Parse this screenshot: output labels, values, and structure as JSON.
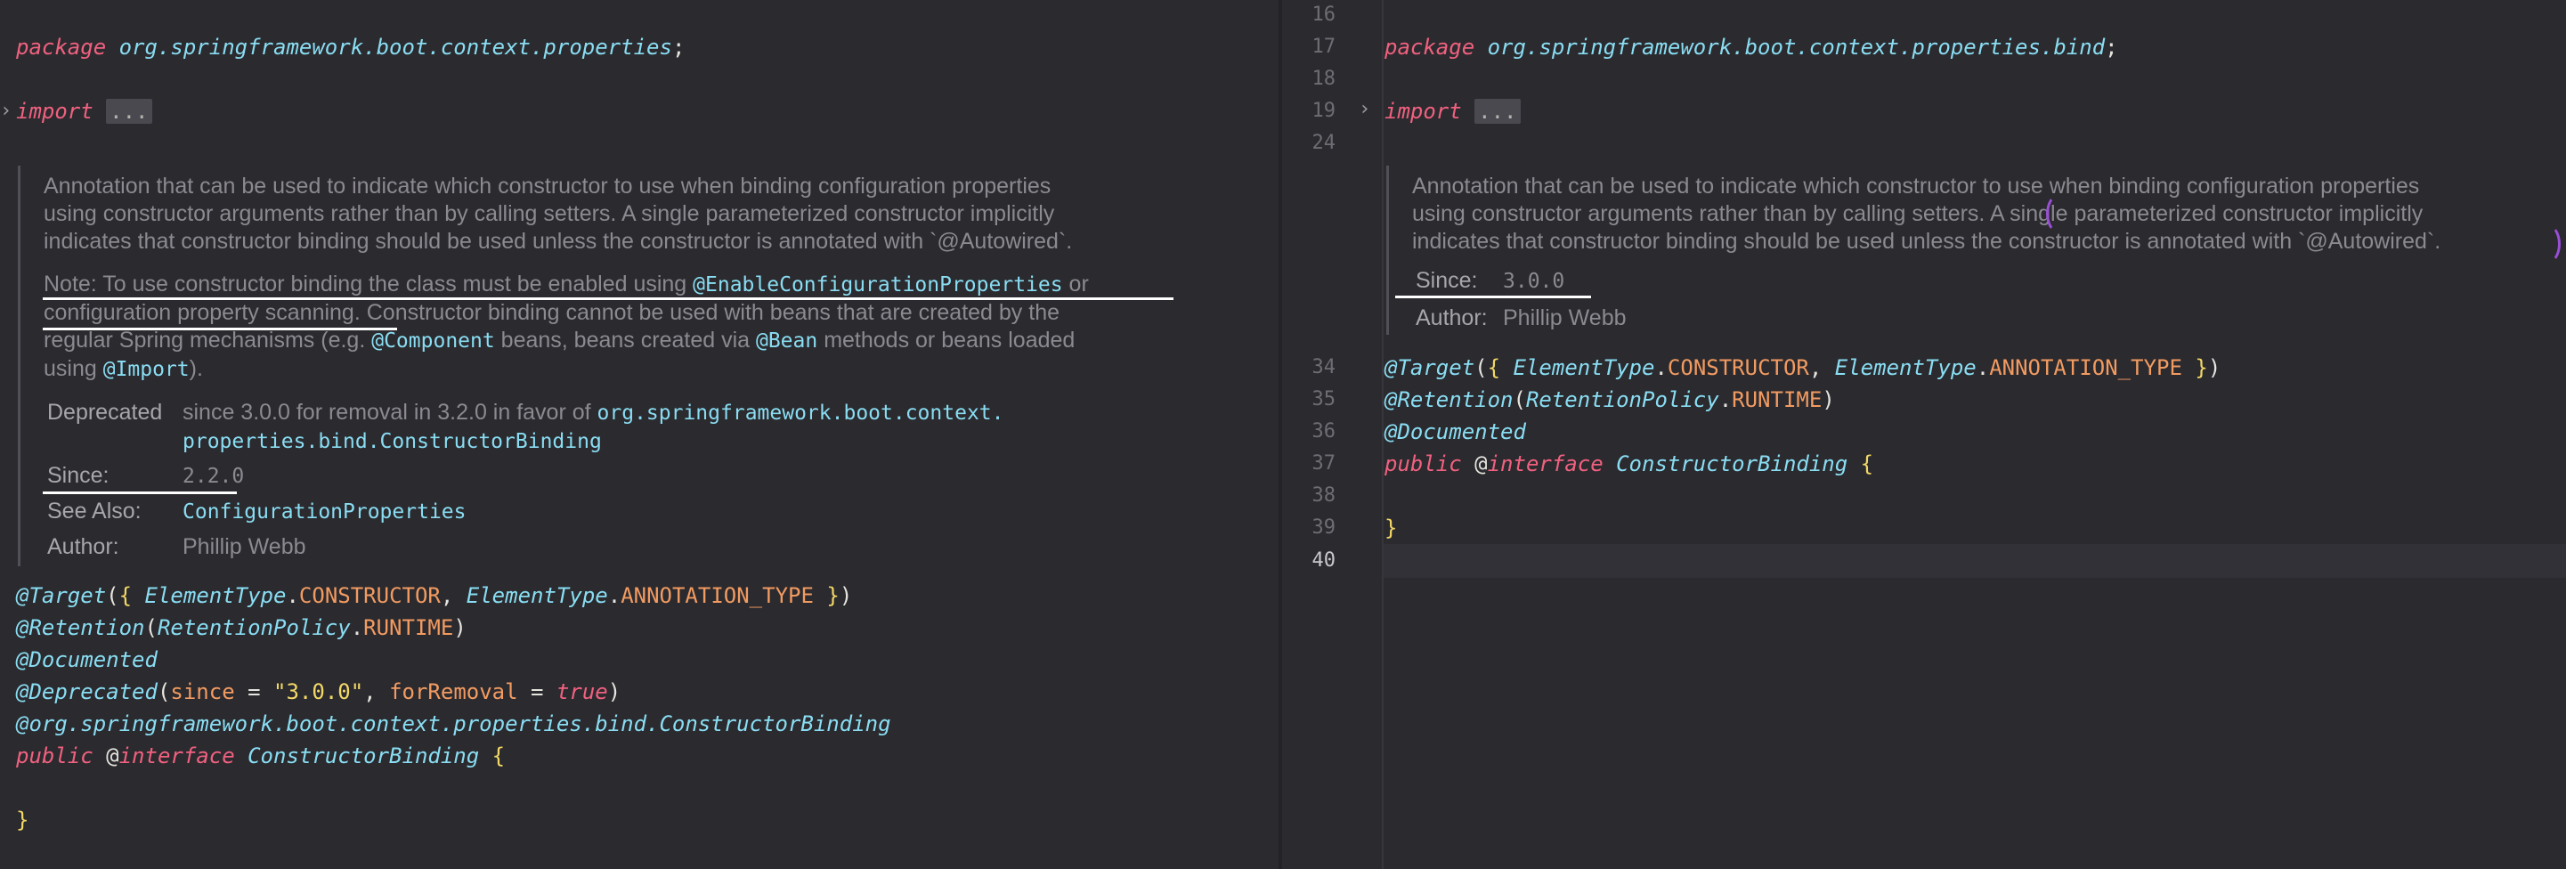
{
  "left": {
    "package_kw": "package",
    "package_name": "org.springframework.boot.context.properties",
    "import_kw": "import",
    "fold_label": "...",
    "doc": {
      "p1": "Annotation that can be used to indicate which constructor to use when binding configuration properties",
      "p2": "using constructor arguments rather than by calling setters. A single parameterized constructor implicitly",
      "p3": "indicates that constructor binding should be used unless the constructor is annotated with `@Autowired`.",
      "note_label": "Note:",
      "note_a": "To use constructor binding the class must be enabled using",
      "note_link1": "@EnableConfigurationProperties",
      "note_or": "or",
      "note_b": "configuration property scanning.",
      "note_c": "Constructor binding cannot be used with beans that are created by the",
      "note_d": "regular Spring mechanisms (e.g.",
      "note_component": "@Component",
      "note_e": "beans, beans created via",
      "note_bean": "@Bean",
      "note_f": "methods or beans loaded",
      "note_g": "using",
      "note_import": "@Import",
      "note_h": ").",
      "deprecated_key": "Deprecated",
      "deprecated_text": "since 3.0.0 for removal in 3.2.0 in favor of",
      "deprecated_ref1": "org.springframework.boot.context.",
      "deprecated_ref2": "properties.bind.ConstructorBinding",
      "since_key": "Since:",
      "since_val": "2.2.0",
      "seealso_key": "See Also:",
      "seealso_val": "ConfigurationProperties",
      "author_key": "Author:",
      "author_val": "Phillip Webb"
    },
    "target_ann": "@Target",
    "element_type": "ElementType",
    "constructor": "CONSTRUCTOR",
    "annotation_type": "ANNOTATION_TYPE",
    "retention_ann": "@Retention",
    "retention_policy": "RetentionPolicy",
    "runtime": "RUNTIME",
    "documented_ann": "@Documented",
    "deprecated_ann": "@Deprecated",
    "since_param": "since",
    "since_value": "\"3.0.0\"",
    "for_removal_param": "forRemoval",
    "true_kw": "true",
    "binding_ann": "@org.springframework.boot.context.properties.bind.ConstructorBinding",
    "public_kw": "public",
    "at": "@",
    "interface_kw": "interface",
    "class_name": "ConstructorBinding",
    "open_brace": "{",
    "close_brace": "}"
  },
  "right": {
    "line_numbers": [
      "16",
      "17",
      "18",
      "19",
      "24",
      "34",
      "35",
      "36",
      "37",
      "38",
      "39",
      "40"
    ],
    "fold_arrow": "›",
    "package_kw": "package",
    "package_name": "org.springframework.boot.context.properties.bind",
    "import_kw": "import",
    "fold_label": "...",
    "doc": {
      "p1": "Annotation that can be used to indicate which constructor to use when binding configuration properties",
      "p2": "using constructor arguments rather than by calling setters. A single parameterized constructor implicitly",
      "p3": "indicates that constructor binding should be used unless the constructor is annotated with `@Autowired`.",
      "since_key": "Since:",
      "since_val": "3.0.0",
      "author_key": "Author:",
      "author_val": "Phillip Webb"
    },
    "target_ann": "@Target",
    "element_type": "ElementType",
    "constructor": "CONSTRUCTOR",
    "annotation_type": "ANNOTATION_TYPE",
    "retention_ann": "@Retention",
    "retention_policy": "RetentionPolicy",
    "runtime": "RUNTIME",
    "documented_ann": "@Documented",
    "public_kw": "public",
    "at": "@",
    "interface_kw": "interface",
    "class_name": "ConstructorBinding",
    "open_brace": "{",
    "close_brace": "}"
  },
  "colors": {
    "background": "#2b2a2f",
    "keyword": "#f0617f",
    "type": "#89ddf2",
    "constant": "#f29b61",
    "string": "#f2d866",
    "doc_text": "#8b8a90",
    "annotation_mark": "#9a4fd6",
    "underline_mark": "#ffffff"
  }
}
